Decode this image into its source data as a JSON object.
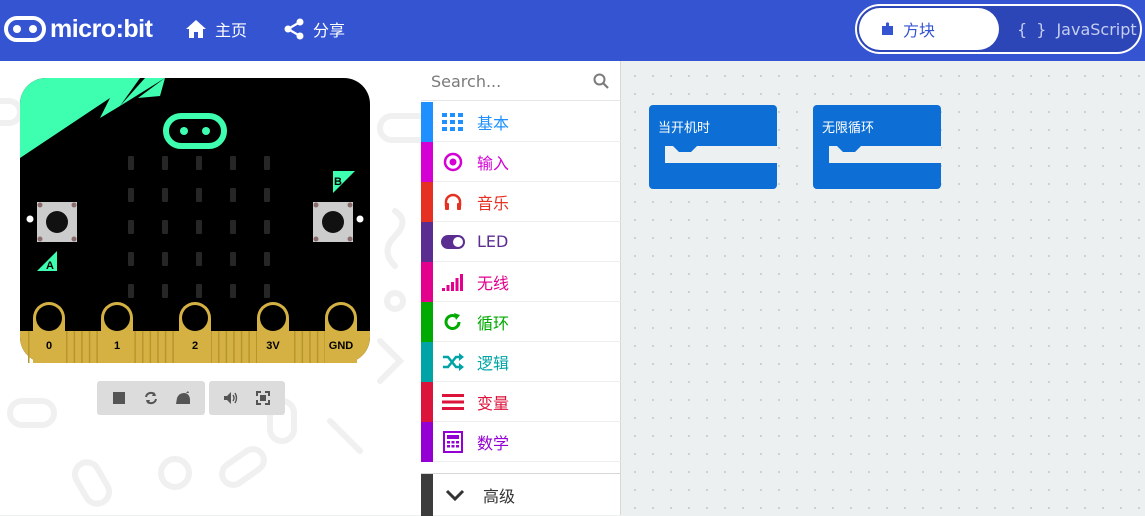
{
  "header": {
    "logo_text": "micro:bit",
    "nav": [
      {
        "label": "主页",
        "icon": "home-icon"
      },
      {
        "label": "分享",
        "icon": "share-icon"
      }
    ],
    "editor_toggle": {
      "blocks_label": "方块",
      "js_label": "JavaScript",
      "js_brackets": "{ }",
      "active": "blocks"
    }
  },
  "simulator": {
    "pin_labels": [
      "0",
      "1",
      "2",
      "3V",
      "GND"
    ],
    "button_labels": [
      "A",
      "B"
    ],
    "controls": [
      "stop-icon",
      "restart-icon",
      "slow-motion-icon",
      "mute-icon",
      "fullscreen-icon"
    ]
  },
  "toolbox": {
    "search_placeholder": "Search...",
    "categories": [
      {
        "label": "基本",
        "color": "#1e90ff",
        "icon": "grid-icon"
      },
      {
        "label": "输入",
        "color": "#d400d4",
        "icon": "input-icon"
      },
      {
        "label": "音乐",
        "color": "#e63022",
        "icon": "headphones-icon"
      },
      {
        "label": "LED",
        "color": "#5c2d91",
        "icon": "toggle-icon"
      },
      {
        "label": "无线",
        "color": "#e3008c",
        "icon": "signal-icon"
      },
      {
        "label": "循环",
        "color": "#00aa00",
        "icon": "loop-icon"
      },
      {
        "label": "逻辑",
        "color": "#00a4a6",
        "icon": "shuffle-icon"
      },
      {
        "label": "变量",
        "color": "#dc143c",
        "icon": "lines-icon"
      },
      {
        "label": "数学",
        "color": "#9400d3",
        "icon": "calculator-icon"
      }
    ],
    "advanced_label": "高级"
  },
  "workspace": {
    "blocks": [
      {
        "label": "当开机时",
        "color": "#1e90ff"
      },
      {
        "label": "无限循环",
        "color": "#1e90ff"
      }
    ]
  }
}
